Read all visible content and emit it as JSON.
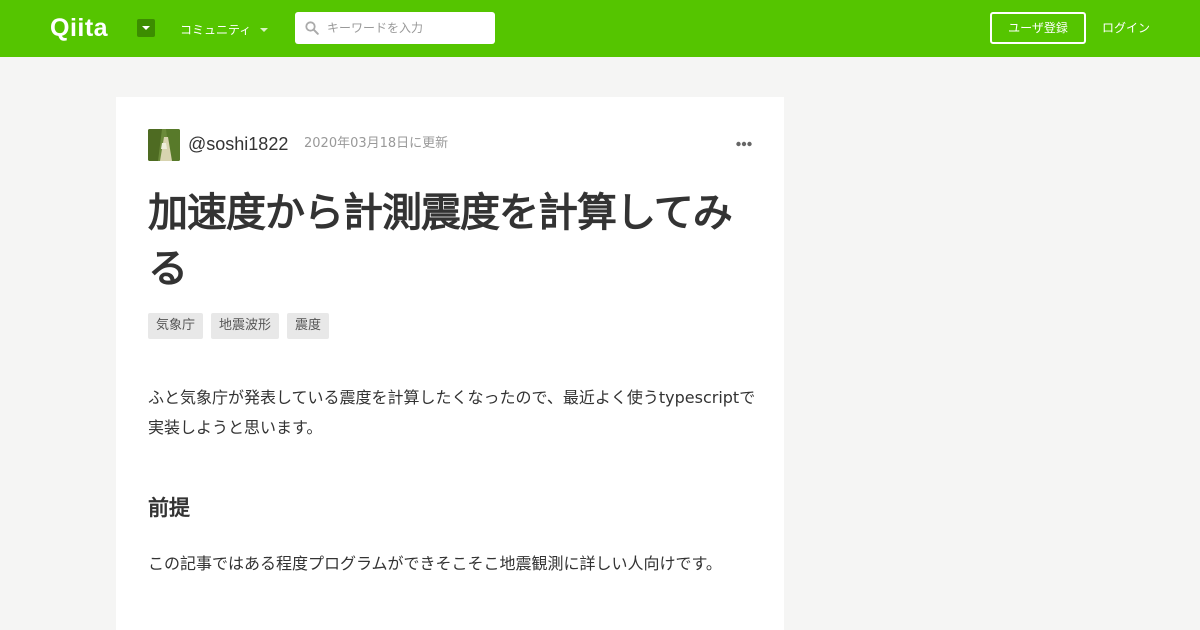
{
  "header": {
    "logo": "Qiita",
    "community_label": "コミュニティ",
    "search_placeholder": "キーワードを入力",
    "search_value": "",
    "signup_label": "ユーザ登録",
    "login_label": "ログイン",
    "brand_color": "#55c500"
  },
  "article": {
    "author": "@soshi1822",
    "updated": "2020年03月18日に更新",
    "title": "加速度から計測震度を計算してみる",
    "tags": [
      "気象庁",
      "地震波形",
      "震度"
    ],
    "paragraph1": "ふと気象庁が発表している震度を計算したくなったので、最近よく使うtypescriptで実装しようと思います。",
    "section_heading": "前提",
    "paragraph2": "この記事ではある程度プログラムができそこそこ地震観測に詳しい人向けです。"
  },
  "icons": {
    "logo_menu": "caret-down-icon",
    "search": "search-icon",
    "more": "more-dots-icon"
  }
}
